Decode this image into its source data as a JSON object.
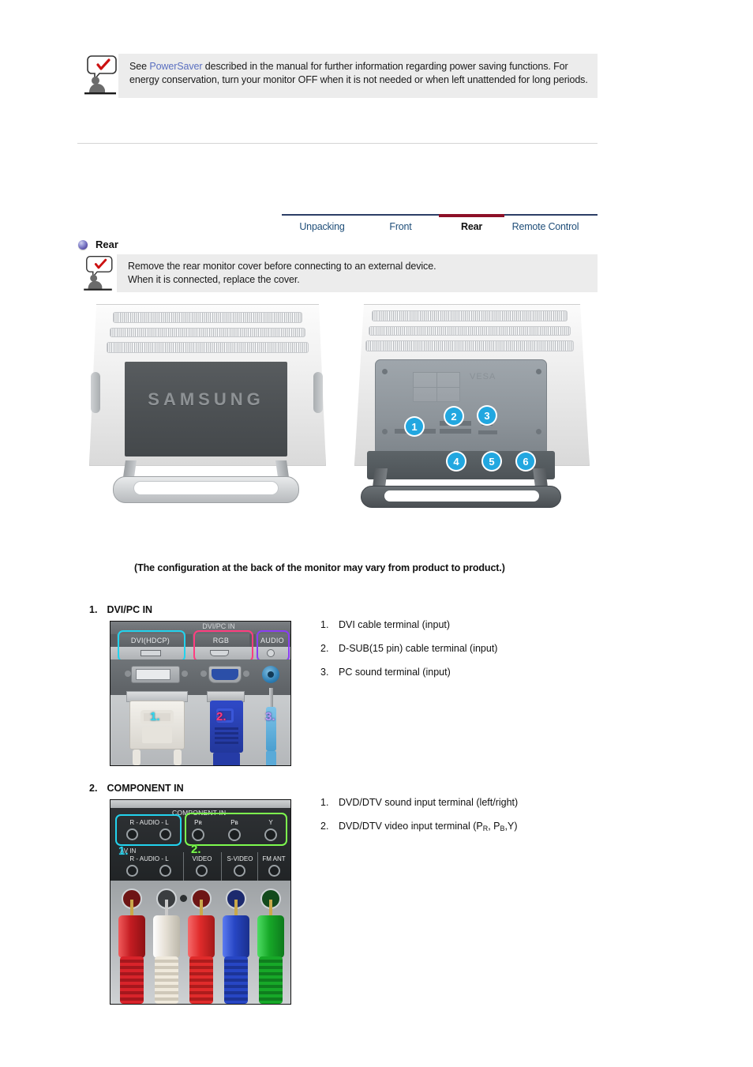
{
  "top_notice": {
    "icon": "person-speech-check-icon",
    "text_before": "See ",
    "highlight": "PowerSaver",
    "text_after": " described in the manual for further information regarding power saving functions. For energy conservation, turn your monitor OFF when it is not needed or when left unattended for long periods."
  },
  "tabs": {
    "items": [
      {
        "label": "Unpacking",
        "active": false
      },
      {
        "label": "Front",
        "active": false
      },
      {
        "label": "Rear",
        "active": true
      },
      {
        "label": "Remote Control",
        "active": false
      }
    ],
    "active_underline_color": "#8d1027",
    "rule_color": "#2c3e66",
    "link_color": "#1f4e79"
  },
  "section": {
    "bullet": "purple-sphere-bullet-icon",
    "title": "Rear",
    "notice": {
      "icon": "person-speech-check-icon",
      "line1": "Remove the rear monitor cover before connecting to an external device.",
      "line2": "When it is connected, replace the cover."
    }
  },
  "monitor_images": {
    "left": {
      "name": "monitor-rear-with-cover",
      "brand": "SAMSUNG"
    },
    "right": {
      "name": "monitor-rear-cover-removed",
      "callouts": [
        "1",
        "2",
        "3",
        "4",
        "5",
        "6"
      ],
      "callout_color": "#22a7e0"
    }
  },
  "caption": "(The configuration at the back of the monitor may vary from product to product.)",
  "sections": [
    {
      "number": "1.",
      "title": "DVI/PC IN",
      "photo": {
        "name": "dvi-pc-in-terminal-photo",
        "header_label": "DVI/PC IN",
        "ports": [
          {
            "label": "DVI(HDCP)",
            "outline_color": "#22d3ee",
            "tag": "1.",
            "tag_color": "#22d3ee"
          },
          {
            "label": "RGB",
            "outline_color": "#ff3d7f",
            "tag": "2.",
            "tag_color": "#ff3d7f"
          },
          {
            "label": "AUDIO",
            "outline_color": "#8b3df5",
            "tag": "3.",
            "tag_color": "#9b6cf0"
          }
        ]
      },
      "items": [
        {
          "num": "1.",
          "text": "DVI cable terminal (input)"
        },
        {
          "num": "2.",
          "text": "D-SUB(15 pin) cable terminal (input)"
        },
        {
          "num": "3.",
          "text": "PC sound terminal (input)"
        }
      ]
    },
    {
      "number": "2.",
      "title": "COMPONENT IN",
      "photo": {
        "name": "component-in-terminal-photo",
        "header_label": "COMPONENT IN",
        "row1": [
          {
            "label": "R - AUDIO - L",
            "outline_color": "#22d3ee",
            "tag": "1.",
            "tag_color": "#22d3ee"
          },
          {
            "label": "Pʙ",
            "outline_color": "#7dfb4e",
            "tag": "2.",
            "tag_color": "#7dfb4e"
          }
        ],
        "component_labels": [
          "Pʀ",
          "Pʙ",
          "Y"
        ],
        "row2_labels": [
          "R - AUDIO - L",
          "VIDEO",
          "S-VIDEO",
          "FM ANT"
        ],
        "av_label": "AV IN",
        "plug_colors": [
          "#d8232a",
          "#efe9dc",
          "#e02b2b",
          "#2746c4",
          "#17a828"
        ]
      },
      "items": [
        {
          "num": "1.",
          "text": "DVD/DTV sound input terminal (left/right)"
        },
        {
          "num": "2.",
          "text": "DVD/DTV video input terminal (P",
          "sub1": "R",
          "mid": ", P",
          "sub2": "B",
          "tail": ",Y)"
        }
      ]
    }
  ]
}
